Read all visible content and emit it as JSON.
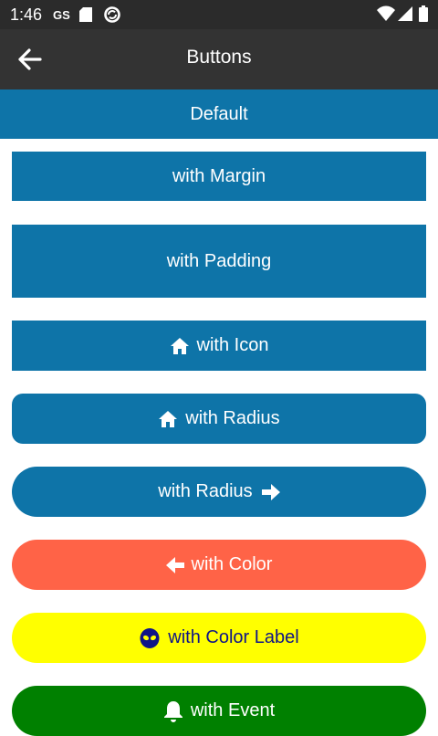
{
  "status_bar": {
    "time": "1:46",
    "carrier_badge": "GS",
    "icons": [
      "sd-card-icon",
      "sync-icon",
      "wifi-icon",
      "signal-icon",
      "battery-icon"
    ]
  },
  "toolbar": {
    "title": "Buttons",
    "back_icon": "arrow-left-icon"
  },
  "buttons": {
    "default": "Default",
    "margin": "with Margin",
    "padding": "with Padding",
    "icon": "with Icon",
    "radius_rounded": "with Radius",
    "radius_pill": "with Radius",
    "color": "with Color",
    "color_label": "with Color Label",
    "event": "with Event"
  },
  "colors": {
    "primary": "#0e74a8",
    "toolbar": "#333333",
    "status_bar": "#2b2b2b",
    "tomato": "#ff6347",
    "yellow": "#ffff00",
    "label_navy": "#0f1487",
    "green": "#008000"
  }
}
